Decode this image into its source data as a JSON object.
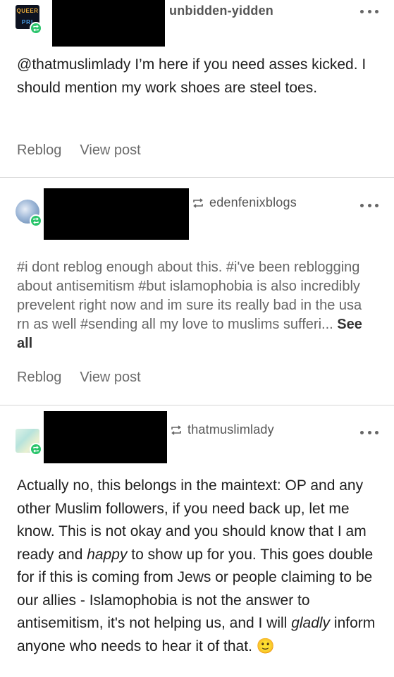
{
  "posts": [
    {
      "username": "unbidden-yidden",
      "avatar_text_top": "QUEER",
      "avatar_text_bottom": "PRI",
      "body": "@thatmuslimlady I’m here if you need asses kicked. I should mention my work shoes are steel toes.",
      "actions": {
        "reblog": "Reblog",
        "view_post": "View post"
      }
    },
    {
      "username": "edenfenixblogs",
      "tags_text": "#i dont reblog enough about this.  #i've been reblogging about antisemitism  #but islamophobia is also incredibly prevelent right now and im sure its really bad in the usa rn as well #sending all my love to muslims sufferi...",
      "see_all": "See all",
      "actions": {
        "reblog": "Reblog",
        "view_post": "View post"
      }
    },
    {
      "username": "thatmuslimlady",
      "body_parts": [
        "Actually no, this belongs in the maintext: OP and any other Muslim followers, if you need back up, let me know. This is not okay and you should know that I am ready and ",
        "happy",
        " to show up for you. This goes double for if this is coming from Jews or people claiming to be our allies - Islamophobia is not the answer to antisemitism, it's not helping us, and I will ",
        "gladly",
        " inform anyone who needs to hear it of that. ",
        "🙂"
      ]
    }
  ],
  "colors": {
    "badge": "#2ac46b",
    "redaction": "#000000",
    "divider": "#d6d6d6"
  },
  "icons": {
    "more": "more-dots-icon",
    "reblog": "reblog-icon"
  }
}
